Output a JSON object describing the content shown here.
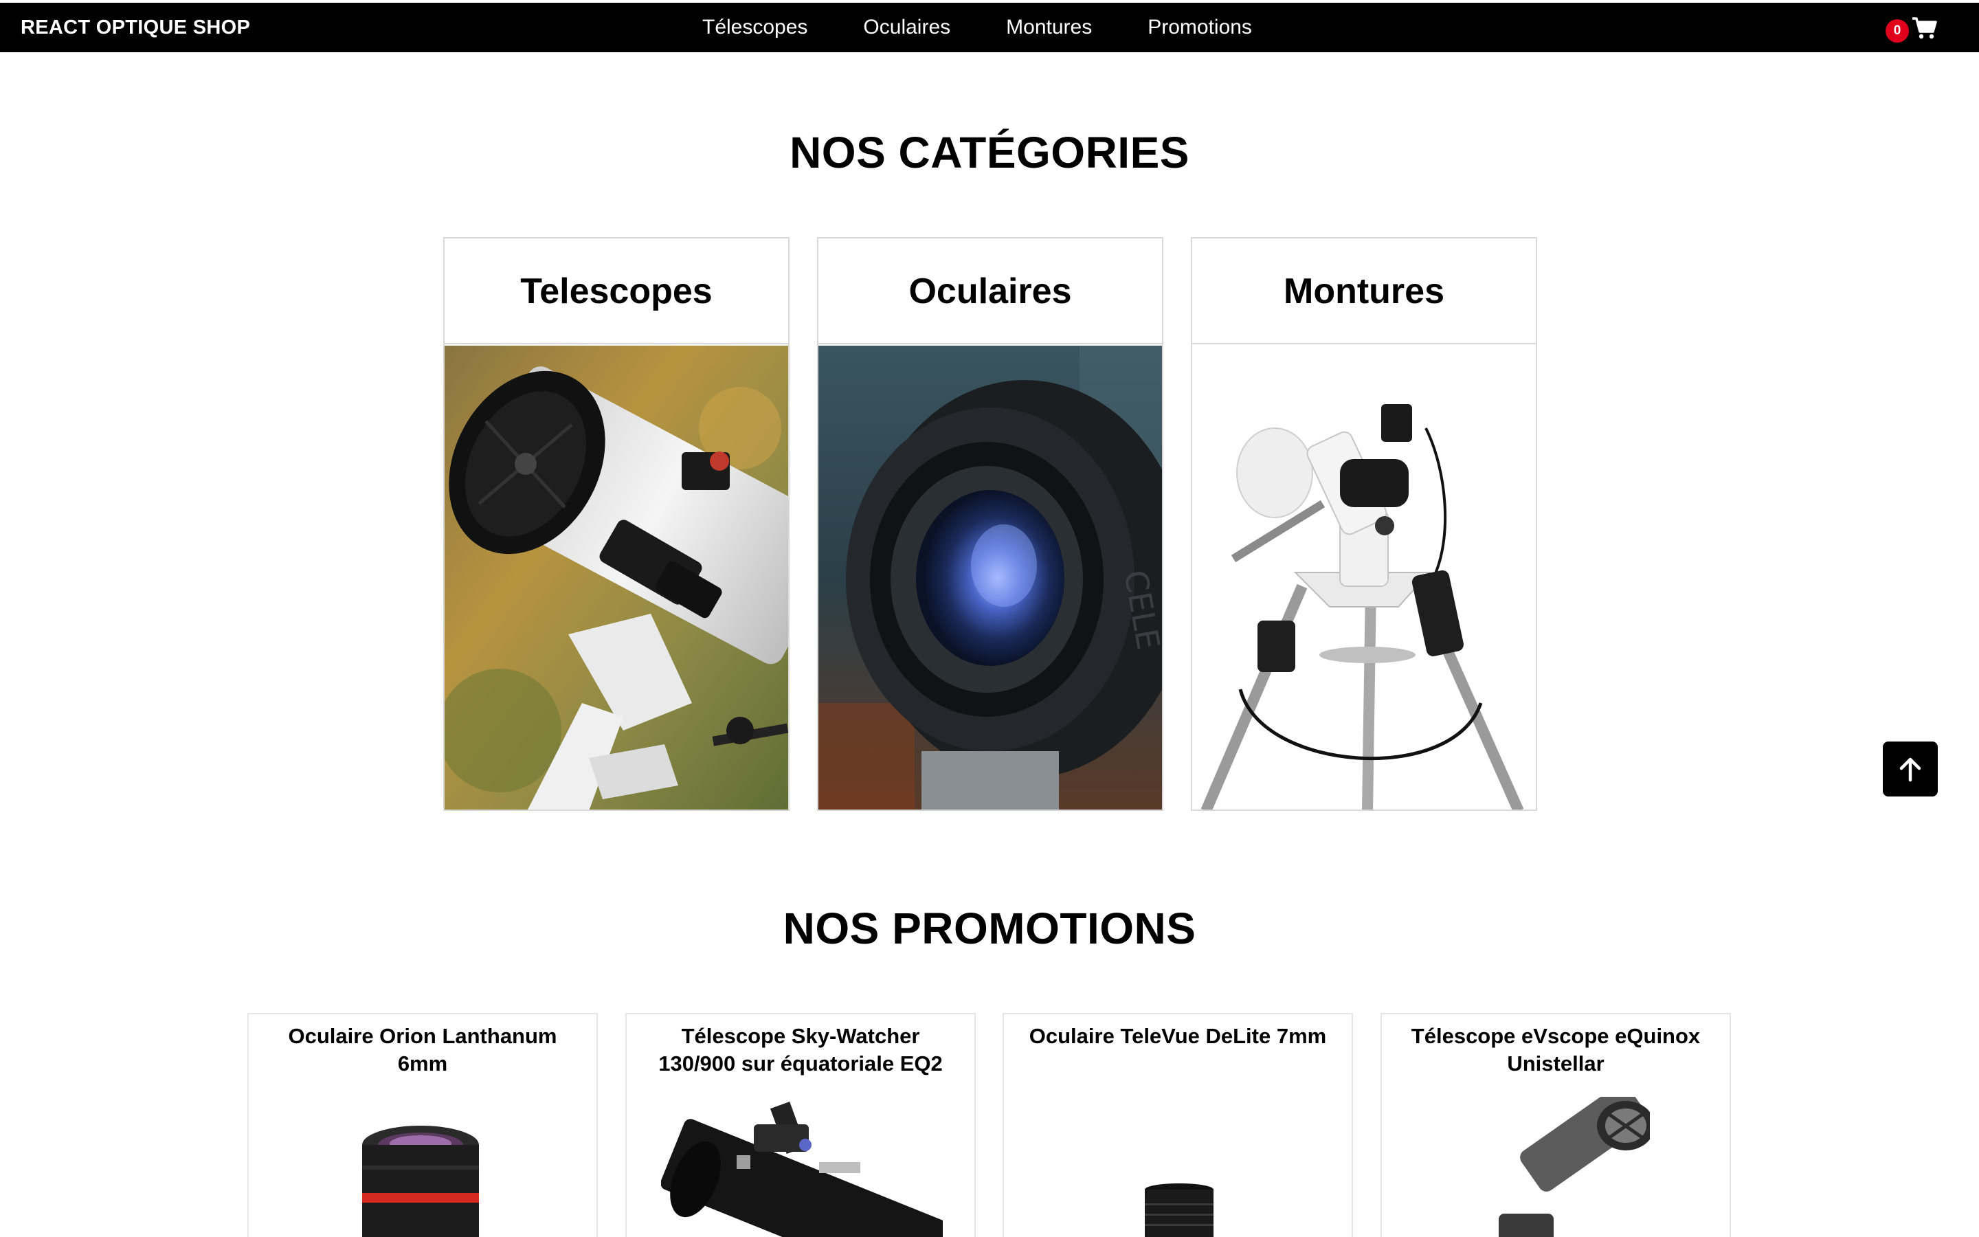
{
  "navbar": {
    "brand": "REACT OPTIQUE SHOP",
    "links": [
      "Télescopes",
      "Oculaires",
      "Montures",
      "Promotions"
    ],
    "cart_count": "0",
    "cart_icon": "shopping-cart-icon",
    "badge_color": "#e0001b"
  },
  "categories": {
    "title": "NOS CATÉGORIES",
    "items": [
      {
        "label": "Telescopes"
      },
      {
        "label": "Oculaires"
      },
      {
        "label": "Montures"
      }
    ]
  },
  "promotions": {
    "title": "NOS PROMOTIONS",
    "items": [
      {
        "name": "Oculaire Orion Lanthanum 6mm"
      },
      {
        "name": "Télescope Sky-Watcher 130/900 sur équatoriale EQ2"
      },
      {
        "name": "Oculaire TeleVue DeLite 7mm"
      },
      {
        "name": "Télescope eVscope eQuinox Unistellar"
      }
    ]
  },
  "scroll_top": {
    "icon": "arrow-up-icon"
  }
}
